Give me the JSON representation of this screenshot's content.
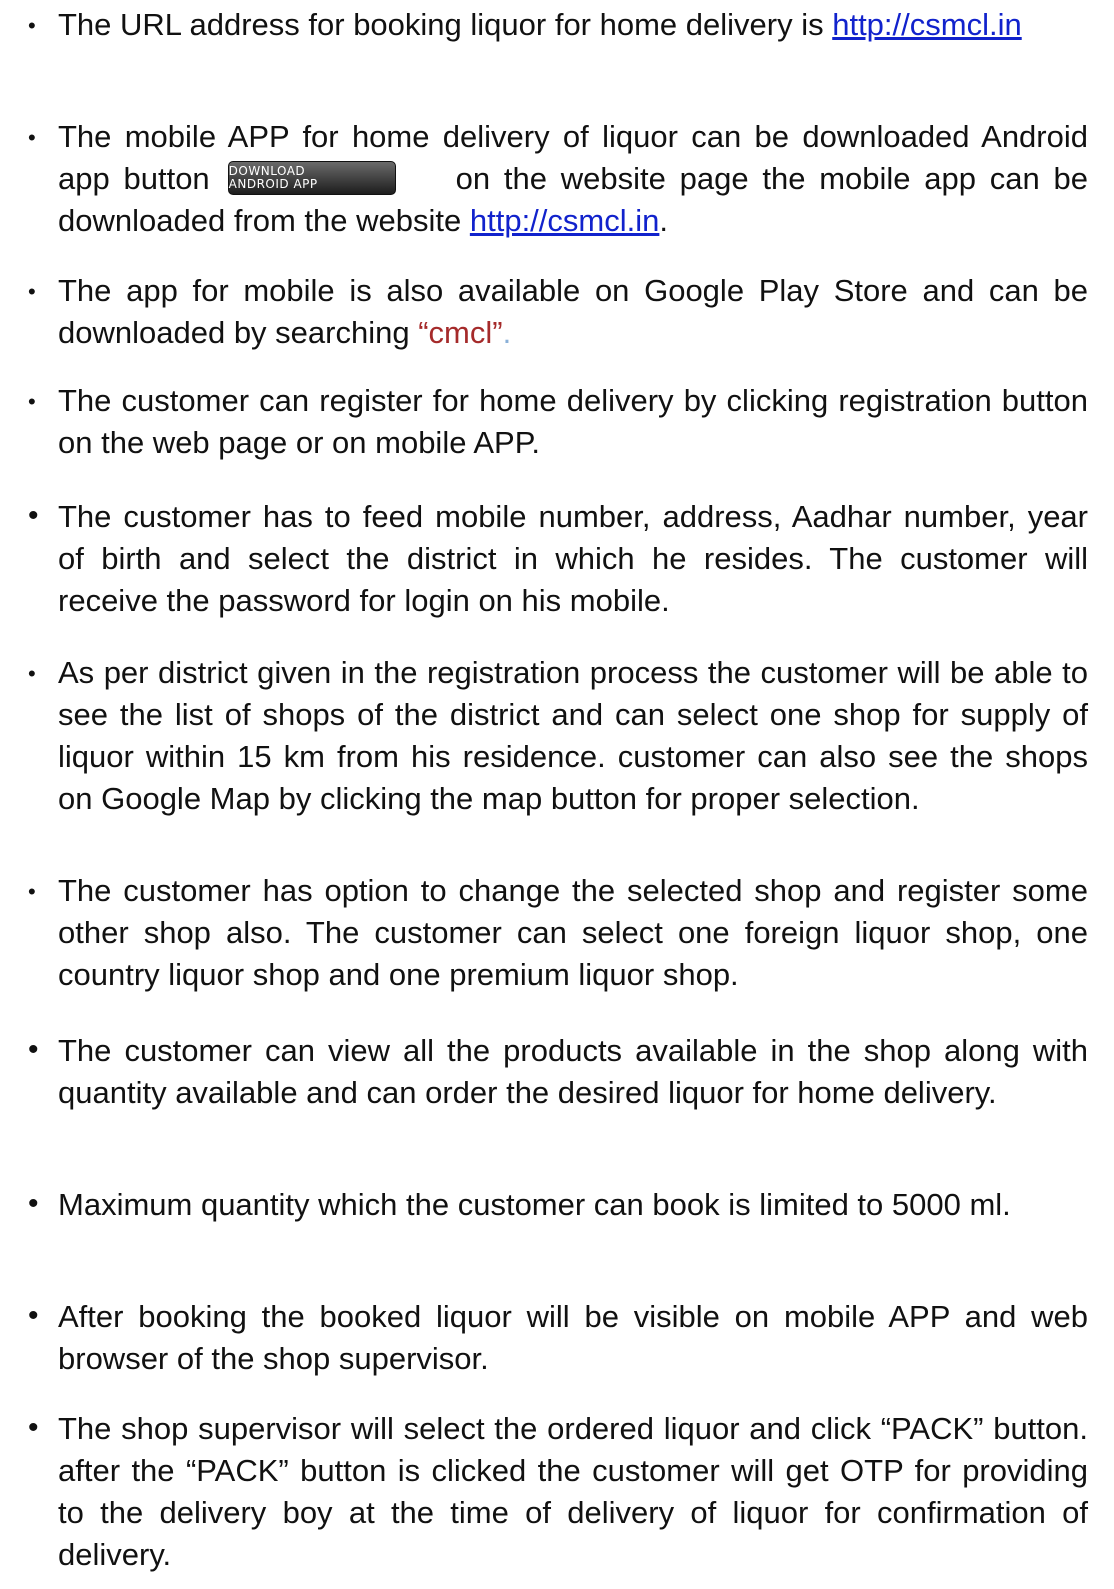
{
  "bullets": [
    {
      "text_before": "The URL address for booking liquor for home delivery is ",
      "link": "http://csmcl.in"
    },
    {
      "text_before": "The mobile APP for home delivery of liquor can be downloaded Android app button",
      "button_label_line1": "DOWNLOAD",
      "button_label_line2": "ANDROID APP",
      "text_after": "on the website page the mobile app can be downloaded from the website ",
      "link": "http://csmcl.in",
      "text_end": "."
    },
    {
      "text_before": "The app for mobile is also available on Google Play Store and can be downloaded by searching ",
      "quoted": "“cmcl”",
      "quoted_end": "."
    },
    {
      "text": "The customer can register for home delivery by clicking registration button on the web page or on mobile APP."
    },
    {
      "text": " The customer has to feed mobile number, address, Aadhar number, year of birth and select the district in which he resides.  The customer will receive the password for login on his mobile."
    },
    {
      "text": " As per district given in the registration process the customer will be able to see the list of shops of the district and can select one shop for supply of liquor within 15 km from his residence.  customer can also see the shops on Google Map by clicking the map button for proper selection."
    },
    {
      "text": " The customer has option   to change the selected shop and register some other shop also.  The customer can select one foreign liquor shop,  one country liquor shop   and one premium liquor shop."
    },
    {
      "text": " The customer can view all the products available in the shop along with quantity available and can order the desired liquor for home delivery."
    },
    {
      "text": "Maximum quantity which the customer can book is limited to 5000 ml."
    },
    {
      "text": " After booking the booked liquor will be visible on mobile APP and web browser of the shop supervisor."
    },
    {
      "text": "The shop supervisor will select the ordered liquor and click “PACK” button.  after the “PACK” button is clicked the customer will get OTP for providing to the delivery boy at the time of delivery of liquor for confirmation of delivery."
    }
  ],
  "bullet_symbol": "•"
}
